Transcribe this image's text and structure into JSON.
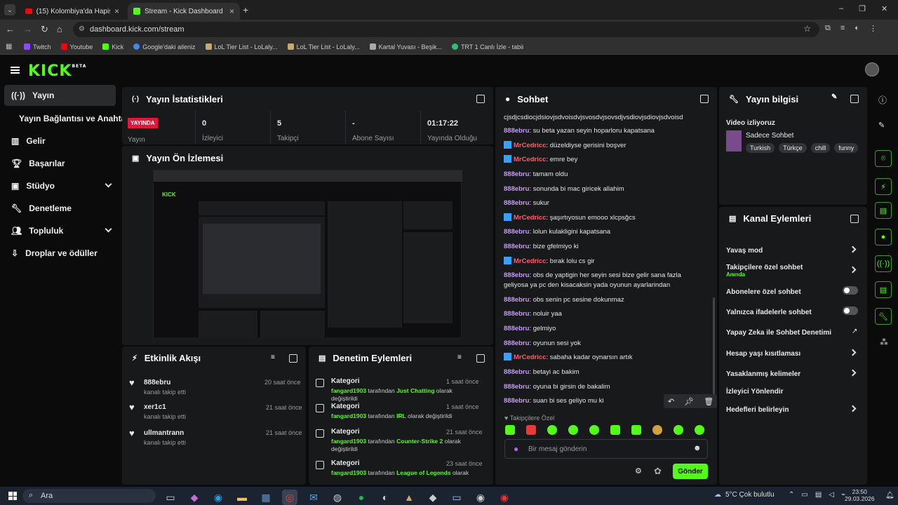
{
  "browser": {
    "tabs": [
      {
        "title": "(15) Kolombiya'da Hapishane İl"
      },
      {
        "title": "Stream - Kick Dashboard"
      }
    ],
    "url": "dashboard.kick.com/stream",
    "bookmarks": [
      "Twitch",
      "Youtube",
      "Kick",
      "Google'daki aileniz",
      "LoL Tier List - LoLaly...",
      "LoL Tier List - LoLaly...",
      "Kartal Yuvası - Beşik...",
      "TRT 1 Canlı İzle - tabii"
    ]
  },
  "app": {
    "logo": "KICK",
    "logo_sup": "BETA"
  },
  "sidebar": {
    "items": [
      {
        "label": "Yayın"
      },
      {
        "label": "Yayın Bağlantısı ve Anahtarı"
      },
      {
        "label": "Gelir"
      },
      {
        "label": "Başarılar"
      },
      {
        "label": "Stüdyo"
      },
      {
        "label": "Denetleme"
      },
      {
        "label": "Topluluk"
      },
      {
        "label": "Droplar ve ödüller"
      }
    ]
  },
  "stats": {
    "title": "Yayın İstatistikleri",
    "live_badge": "YAYINDA",
    "live_label": "Yayın",
    "items": [
      {
        "value": "0",
        "label": "İzleyici"
      },
      {
        "value": "5",
        "label": "Takipçi"
      },
      {
        "value": "-",
        "label": "Abone Sayısı"
      },
      {
        "value": "01:17:22",
        "label": "Yayında Olduğu"
      }
    ]
  },
  "preview": {
    "title": "Yayın Ön İzlemesi"
  },
  "activity": {
    "title": "Etkinlik Akışı",
    "items": [
      {
        "name": "888ebru",
        "desc": "kanalı takip etti",
        "time": "20 saat önce"
      },
      {
        "name": "xer1c1",
        "desc": "kanalı takip etti",
        "time": "21 saat önce"
      },
      {
        "name": "ullmantrann",
        "desc": "kanalı takip etti",
        "time": "21 saat önce"
      }
    ]
  },
  "moderation": {
    "title": "Denetim Eylemleri",
    "items": [
      {
        "kind": "Kategori",
        "user": "fangard1903",
        "mid": " tarafından ",
        "cat": "Just Chatting",
        "tail": " olarak değiştirildi",
        "time": "1 saat önce"
      },
      {
        "kind": "Kategori",
        "user": "fangard1903",
        "mid": " tarafından ",
        "cat": "IRL",
        "tail": " olarak değiştirildi",
        "time": "1 saat önce"
      },
      {
        "kind": "Kategori",
        "user": "fangard1903",
        "mid": " tarafından ",
        "cat": "Counter-Strike 2",
        "tail": " olarak değiştirildi",
        "time": "21 saat önce"
      },
      {
        "kind": "Kategori",
        "user": "fangard1903",
        "mid": " tarafından ",
        "cat": "League of Legends",
        "tail": " olarak",
        "time": "23 saat önce"
      }
    ]
  },
  "chat": {
    "title": "Sohbet",
    "top_line": "cjsdjcsdiocjdsiovjsdvoisdvjsvosdvjsovsdjvsdiovjsdiovjsdvoisd",
    "messages": [
      {
        "user": "888ebru",
        "kind": "u1",
        "text": ": su beta yazan seyin hoparloru kapatsana"
      },
      {
        "user": "MrCedricc",
        "kind": "u2",
        "text": ": düzeldiyse gerisini boşver"
      },
      {
        "user": "MrCedricc",
        "kind": "u2",
        "text": ": emre bey"
      },
      {
        "user": "888ebru",
        "kind": "u1",
        "text": ": tamam oldu"
      },
      {
        "user": "888ebru",
        "kind": "u1",
        "text": ": sonunda bi mac giricek allahim"
      },
      {
        "user": "888ebru",
        "kind": "u1",
        "text": ": sukur"
      },
      {
        "user": "MrCedricc",
        "kind": "u2",
        "text": ": şaşırtıyosun emooo xlcpsğcs"
      },
      {
        "user": "888ebru",
        "kind": "u1",
        "text": ": lolun kulakligini kapatsana"
      },
      {
        "user": "888ebru",
        "kind": "u1",
        "text": ": bize gfelmiyo ki"
      },
      {
        "user": "MrCedricc",
        "kind": "u2",
        "text": ": bırak lolu cs gir"
      },
      {
        "user": "888ebru",
        "kind": "u1",
        "text": ": obs de yaptigin her seyin sesi bize gelir sana fazla geliyosa ya pc den kisacaksin yada oyunun ayarlarindan"
      },
      {
        "user": "888ebru",
        "kind": "u1",
        "text": ": obs senin pc sesine dokunmaz"
      },
      {
        "user": "888ebru",
        "kind": "u1",
        "text": ": noluir yaa"
      },
      {
        "user": "888ebru",
        "kind": "u1",
        "text": ": gelmiyo"
      },
      {
        "user": "888ebru",
        "kind": "u1",
        "text": ": oyunun sesi yok"
      },
      {
        "user": "MrCedricc",
        "kind": "u2",
        "text": ": sabaha kadar oynarsın artık"
      },
      {
        "user": "888ebru",
        "kind": "u1",
        "text": ": betayi ac bakim"
      },
      {
        "user": "888ebru",
        "kind": "u1",
        "text": ": oyuna bi girsin de bakalim"
      },
      {
        "user": "888ebru",
        "kind": "u1",
        "text": ": suan bi ses geliyo mu ki"
      }
    ],
    "mode_label": "Takipçilere Özel",
    "input_placeholder": "Bir mesaj gönderin",
    "send_label": "Gönder"
  },
  "stream_info": {
    "title": "Yayın bilgisi",
    "watching_label": "Video izliyoruz",
    "stream_title": "Sadece Sohbet",
    "tags": [
      "Turkish",
      "Türkçe",
      "chill",
      "funny"
    ]
  },
  "channel_actions": {
    "title": "Kanal Eylemleri",
    "items": [
      {
        "label": "Yavaş mod",
        "sub": "",
        "control": "chevron"
      },
      {
        "label": "Takipçilere özel sohbet",
        "sub": "Anında",
        "control": "chevron"
      },
      {
        "label": "Abonelere özel sohbet",
        "sub": "",
        "control": "toggle"
      },
      {
        "label": "Yalnızca ifadelerle sohbet",
        "sub": "",
        "control": "toggle"
      },
      {
        "label": "Yapay Zeka ile Sohbet Denetimi",
        "sub": "",
        "control": "external"
      },
      {
        "label": "Hesap yaşı kısıtlaması",
        "sub": "",
        "control": "chevron"
      },
      {
        "label": "Yasaklanmış kelimeler",
        "sub": "",
        "control": "chevron"
      },
      {
        "label": "İzleyici Yönlendir",
        "sub": "",
        "control": "none"
      },
      {
        "label": "Hedefleri belirleyin",
        "sub": "",
        "control": "chevron"
      }
    ]
  },
  "taskbar": {
    "search_label": "Ara",
    "weather": "5°C  Çok bulutlu",
    "time": "23:50",
    "date": "29.03.2026"
  },
  "colors": {
    "accent": "#53fc18",
    "panel": "#18191b",
    "bg": "#0b0b0c"
  }
}
